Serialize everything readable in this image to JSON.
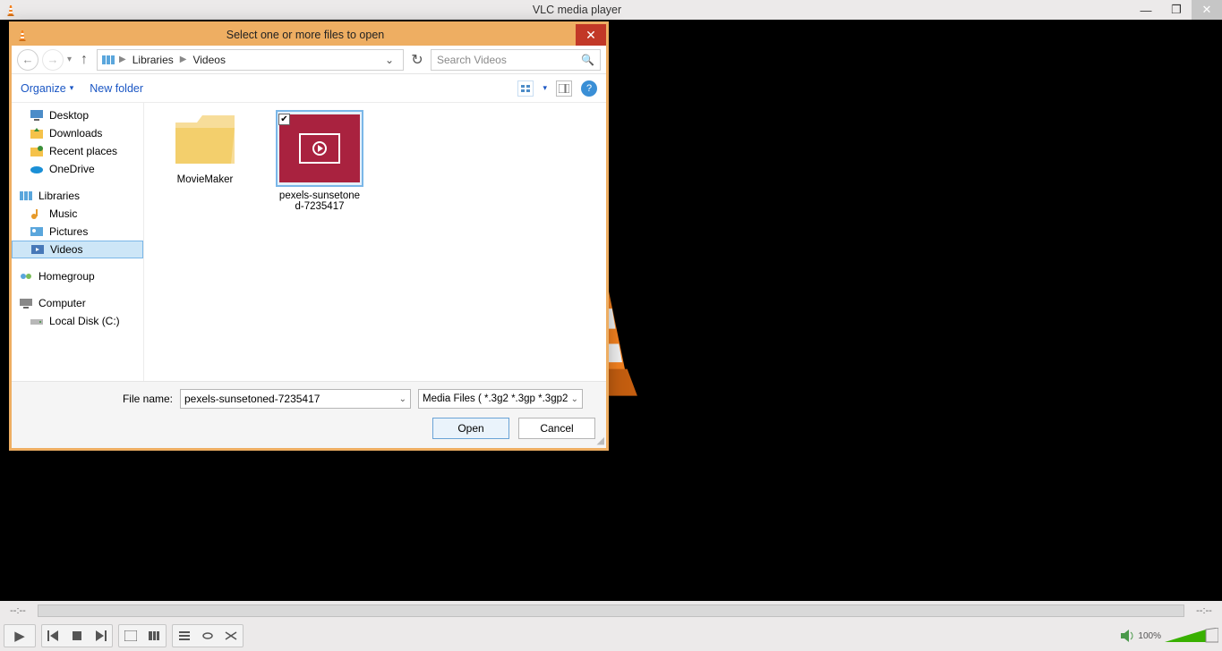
{
  "app": {
    "title": "VLC media player",
    "time_current": "--:--",
    "time_total": "--:--",
    "volume_pct": "100%"
  },
  "window_buttons": {
    "min": "—",
    "max": "❐",
    "close": "✕"
  },
  "controls": {
    "play": "▶",
    "prev": "|◀◀",
    "stop": "■",
    "next": "▶▶|",
    "fullscreen": "⛶",
    "extended": "⊞",
    "playlist": "≣",
    "loop": "⟲",
    "random": "✕↔"
  },
  "dialog": {
    "title": "Select one or more files to open",
    "close": "✕",
    "breadcrumb": [
      "Libraries",
      "Videos"
    ],
    "refresh_tip": "Refresh",
    "search_placeholder": "Search Videos",
    "toolbar": {
      "organize": "Organize",
      "organize_arrow": "▾",
      "new_folder": "New folder",
      "view_arrow": "▾",
      "help": "?"
    },
    "tree": [
      {
        "icon": "desktop",
        "label": "Desktop",
        "lvl": 1
      },
      {
        "icon": "downloads",
        "label": "Downloads",
        "lvl": 1
      },
      {
        "icon": "recent",
        "label": "Recent places",
        "lvl": 1
      },
      {
        "icon": "onedrive",
        "label": "OneDrive",
        "lvl": 1
      },
      {
        "icon": "",
        "label": "",
        "lvl": 1,
        "spacer": true
      },
      {
        "icon": "libraries",
        "label": "Libraries",
        "lvl": 0
      },
      {
        "icon": "music",
        "label": "Music",
        "lvl": 1
      },
      {
        "icon": "pictures",
        "label": "Pictures",
        "lvl": 1
      },
      {
        "icon": "videos",
        "label": "Videos",
        "lvl": 1,
        "selected": true
      },
      {
        "icon": "",
        "label": "",
        "lvl": 1,
        "spacer": true
      },
      {
        "icon": "homegroup",
        "label": "Homegroup",
        "lvl": 0
      },
      {
        "icon": "",
        "label": "",
        "lvl": 1,
        "spacer": true
      },
      {
        "icon": "computer",
        "label": "Computer",
        "lvl": 0
      },
      {
        "icon": "drive",
        "label": "Local Disk (C:)",
        "lvl": 1
      }
    ],
    "items": [
      {
        "type": "folder",
        "label": "MovieMaker",
        "selected": false
      },
      {
        "type": "video",
        "label": "pexels-sunsetoned-7235417",
        "selected": true,
        "checked": true
      }
    ],
    "filename_label": "File name:",
    "filename_value": "pexels-sunsetoned-7235417",
    "filetype_value": "Media Files ( *.3g2 *.3gp *.3gp2",
    "open_btn": "Open",
    "cancel_btn": "Cancel"
  }
}
